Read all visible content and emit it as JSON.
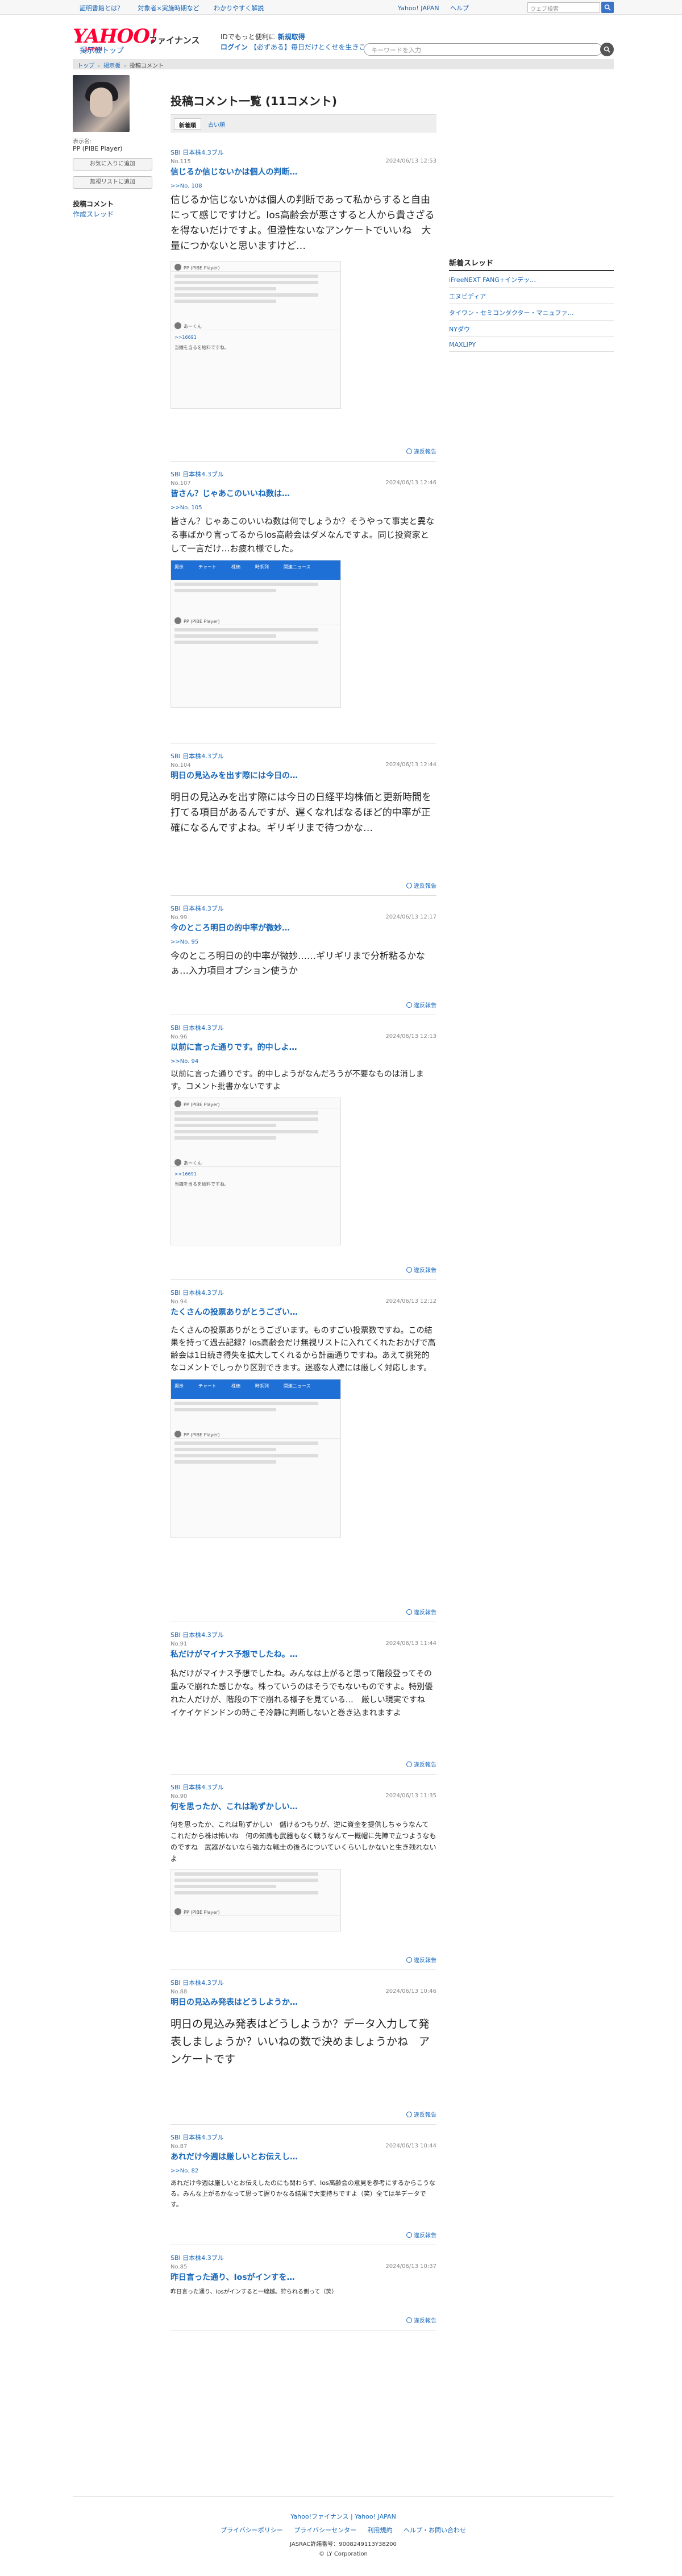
{
  "topbar": {
    "links": [
      "証明書籍とは？",
      "対象者×実施時期など",
      "わかりやすく解説"
    ],
    "right_links": [
      "Yahoo! JAPAN",
      "ヘルプ"
    ],
    "search_placeholder": "ウェブ検索"
  },
  "header": {
    "logo": "YAHOO!",
    "logo_sub": "JAPAN",
    "service": "ファイナンス",
    "promo_line1_a": "IDでもっと便利に",
    "promo_line1_b": "新規取得",
    "promo_line2_a": "ログイン",
    "promo_line2_b": "【必ずある】毎日だけとくせを生きこちら",
    "board_link": "掲示板トップ",
    "search_placeholder": "キーワードを入力"
  },
  "breadcrumb": [
    "トップ",
    "掲示板",
    "投稿コメント"
  ],
  "profile": {
    "label": "表示名:",
    "name": "PP (PIBE Player)",
    "btn_favorite": "お気に入りに追加",
    "btn_ignore": "無視リストに追加",
    "nav_active": "投稿コメント",
    "nav_link": "作成スレッド"
  },
  "main": {
    "title": "投稿コメント一覧 (11コメント)",
    "tab_new": "新着順",
    "tab_old": "古い順"
  },
  "report_label": "違反報告",
  "comments": [
    {
      "user": "SBI 日本株4.3ブル",
      "no": "No.115",
      "date": "2024/06/13 12:53",
      "title": "信じるか信じないかは個人の判断…",
      "reply": ">>No. 108",
      "body": "信じるか信じないかは個人の判断であって私からすると自由にって感じですけど。Ios高齢会が悪さすると人から貴さざるを得ないだけですよ。但澄性ないなアンケートでいいね　大量につかないと思いますけど…",
      "embed_user": "PP (PIBE Player)",
      "embed_user2": "あーくん",
      "embed_reply": ">>16691",
      "embed_text": "当鐘を当るを給料ですね。"
    },
    {
      "user": "SBI 日本株4.3ブル",
      "no": "No.107",
      "date": "2024/06/13 12:46",
      "title": "皆さん？じゃあこのいいね数は…",
      "reply": ">>No. 105",
      "body": "皆さん？じゃあこのいいね数は何でしょうか？そうやって事実と異なる事ばかり言ってるからIos高齢会はダメなんですよ。同じ投資家として一言だけ…お疲れ様でした。",
      "embed_user": "PP (PIBE Player)",
      "tabs": [
        "掲示",
        "チャート",
        "株価",
        "時系列",
        "関連ニュース"
      ]
    },
    {
      "user": "SBI 日本株4.3ブル",
      "no": "No.104",
      "date": "2024/06/13 12:44",
      "title": "明日の見込みを出す際には今日の…",
      "body": "明日の見込みを出す際には今日の日経平均株価と更新時間を打てる項目があるんですが、遅くなればなるほど的中率が正確になるんですよね。ギリギリまで待つかな…"
    },
    {
      "user": "SBI 日本株4.3ブル",
      "no": "No.99",
      "date": "2024/06/13 12:17",
      "title": "今のところ明日の的中率が微妙…",
      "reply": ">>No. 95",
      "body": "今のところ明日の的中率が微妙……ギリギリまで分析粘るかなぁ…入力項目オプション使うか"
    },
    {
      "user": "SBI 日本株4.3ブル",
      "no": "No.96",
      "date": "2024/06/13 12:13",
      "title": "以前に言った通りです。的中しよ…",
      "reply": ">>No. 94",
      "body": "以前に言った通りです。的中しようがなんだろうが不要なものは消します。コメント批書かないですよ",
      "embed_user": "PP (PIBE Player)",
      "embed_user2": "あーくん",
      "embed_reply": ">>16691",
      "embed_text": "当鐘を当るを給料ですね。"
    },
    {
      "user": "SBI 日本株4.3ブル",
      "no": "No.94",
      "date": "2024/06/13 12:12",
      "title": "たくさんの投票ありがとうござい…",
      "body": "たくさんの投票ありがとうございます。ものすごい投票数ですね。この結果を持って過去記録？Ios高齢会だけ無視リストに入れてくれたおかげで高齢会は1日続き得失を拡大してくれるから計画通りですね。あえて挑発的なコメントでしっかり区別できます。迷惑な人達には厳しく対応します。",
      "embed_user": "PP (PIBE Player)",
      "tabs": [
        "掲示",
        "チャート",
        "株価",
        "時系列",
        "関連ニュース"
      ]
    },
    {
      "user": "SBI 日本株4.3ブル",
      "no": "No.91",
      "date": "2024/06/13 11:44",
      "title": "私だけがマイナス予想でしたね。…",
      "body": "私だけがマイナス予想でしたね。みんなは上がると思って階段登ってその重みで崩れた感じかな。株っていうのはそうでもないものですよ。特別優れた人だけが、階段の下で崩れる様子を見ている…　厳しい現実ですね　イケイケドンドンの時こそ冷静に判断しないと巻き込まれますよ"
    },
    {
      "user": "SBI 日本株4.3ブル",
      "no": "No.90",
      "date": "2024/06/13 11:35",
      "title": "何を思ったか、これは恥ずかしい…",
      "body": "何を思ったか、これは恥ずかしい　儲けるつもりが、逆に資金を提供しちゃうなんて　これだから株は怖いね　何の知識も武器もなく戦うなんて一概帽に先陣で立つようなものですね　武器がないなら強力な戦士の後ろについていくらいしかないと生き残れないよ",
      "embed_user": "PP (PIBE Player)"
    },
    {
      "user": "SBI 日本株4.3ブル",
      "no": "No.88",
      "date": "2024/06/13 10:46",
      "title": "明日の見込み発表はどうしようか…",
      "body": "明日の見込み発表はどうしようか？データ入力して発表しましょうか？いいねの数で決めましょうかね　アンケートです"
    },
    {
      "user": "SBI 日本株4.3ブル",
      "no": "No.87",
      "date": "2024/06/13 10:44",
      "title": "あれだけ今週は厳しいとお伝えし…",
      "reply": ">>No. 82",
      "body": "あれだけ今週は厳しいとお伝えしたのにも関わらず、Ios高齢会の意見を参考にするからこうなる。みんな上がるかなって思って握りかなる結果で大変持ちですよ（笑）全ては半データです。"
    },
    {
      "user": "SBI 日本株4.3ブル",
      "no": "No.85",
      "date": "2024/06/13 10:37",
      "title": "昨日言った通り、Iosがインすを…",
      "body": "昨日言った通り、Iosがインすると一線越。狩られる側って（笑）"
    }
  ],
  "right": {
    "title": "新着スレッド",
    "items": [
      "iFreeNEXT FANG+インデッ…",
      "エヌビディア",
      "タイワン・セミコンダクター・マニュファ…",
      "NYダウ",
      "MAXLIPY"
    ]
  },
  "footer": {
    "links1": [
      "Yahoo!ファイナンス",
      "Yahoo! JAPAN"
    ],
    "links2": [
      "プライバシーポリシー",
      "プライバシーセンター",
      "利用規約",
      "ヘルプ・お問い合わせ"
    ],
    "register": "JASRAC許諾番号：9008249113Y38200",
    "copyright": "© LY Corporation"
  }
}
